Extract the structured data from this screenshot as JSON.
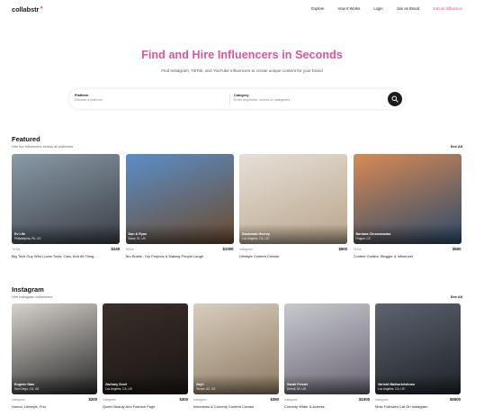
{
  "nav": {
    "logo": "collabstr",
    "links": [
      "Explore",
      "How It Works",
      "Login",
      "Join as Brand",
      "Join as Influencer"
    ]
  },
  "hero": {
    "title": "Find and Hire Influencers in Seconds",
    "subtitle": "Find Instagram, TikTok, and YouTube influencers to create unique content for your brand"
  },
  "search": {
    "platform_label": "Platform",
    "platform_placeholder": "Choose a platform",
    "category_label": "Category",
    "category_placeholder": "Enter keywords, niches or categories"
  },
  "featured": {
    "title": "Featured",
    "subtitle": "Hire top influencers across all platforms",
    "see_all": "See All",
    "cards": [
      {
        "name": "Ev Life",
        "location": "Philadelphia, PA, US",
        "platform": "TikTok",
        "price": "$249",
        "desc": "Big Tech Guy Who Loves Tools, Cars, And All Thing...",
        "c1": "#8a9aa8",
        "c2": "#3a3f45"
      },
      {
        "name": "Dan & Ryan",
        "location": "Boise, ID, US",
        "platform": "TikTok",
        "price": "$1000",
        "desc": "Bro Builds - Diy Projects & Making People Laugh",
        "c1": "#5b8ec9",
        "c2": "#6b4a2e"
      },
      {
        "name": "Savannah Hovrey",
        "location": "Los Angeles, CA, US",
        "platform": "Instagram",
        "price": "$500",
        "desc": "Lifestyle Content Creator",
        "c1": "#e6e0d8",
        "c2": "#b9a48a"
      },
      {
        "name": "Barbara Chrzanowska",
        "location": "Prague, CZ",
        "platform": "TikTok",
        "price": "$500",
        "desc": "Content Creator, Blogger & Influencer",
        "c1": "#d98a55",
        "c2": "#2c4a6a"
      }
    ]
  },
  "instagram": {
    "title": "Instagram",
    "subtitle": "Hire Instagram influencers",
    "see_all": "See All",
    "cards": [
      {
        "name": "Eugene Nam",
        "location": "San Diego, CA, US",
        "platform": "Instagram",
        "price": "$200",
        "desc": "Humor, Lifestyle, Fun",
        "c1": "#d7d2cc",
        "c2": "#2a2a2a"
      },
      {
        "name": "Zachary Zorel",
        "location": "Los Angeles, CA, US",
        "platform": "Instagram",
        "price": "$300",
        "desc": "Queer Beauty And Fashion Page",
        "c1": "#3a2f2a",
        "c2": "#1a1614"
      },
      {
        "name": "Zayh",
        "location": "Tempe, AZ, US",
        "platform": "Instagram",
        "price": "$350",
        "desc": "Interviews & Comedy Content Creator",
        "c1": "#d9cdbd",
        "c2": "#8d7a62"
      },
      {
        "name": "Sarah Ferrari",
        "location": "Detroit, MI, US",
        "platform": "Instagram",
        "price": "$1000",
        "desc": "Comedy Writer & Actress",
        "c1": "#c8cad0",
        "c2": "#6a6470"
      },
      {
        "name": "Varisht Mathurkrishnan",
        "location": "Los Angeles, CA, US",
        "platform": "Instagram",
        "price": "$5500",
        "desc": "Most Followed Cat On Instagram",
        "c1": "#5d6470",
        "c2": "#1f2228"
      }
    ]
  }
}
